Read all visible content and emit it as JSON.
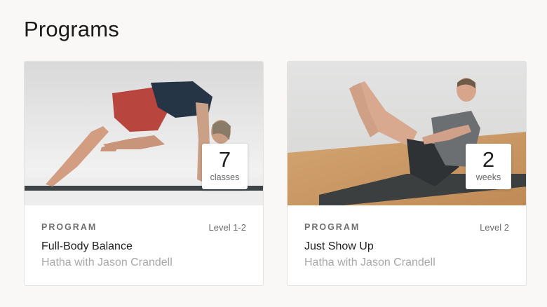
{
  "page": {
    "title": "Programs"
  },
  "programs": [
    {
      "kind_label": "PROGRAM",
      "level": "Level 1-2",
      "title": "Full-Body Balance",
      "subtitle": "Hatha with Jason Crandell",
      "count": "7",
      "count_unit": "classes"
    },
    {
      "kind_label": "PROGRAM",
      "level": "Level 2",
      "title": "Just Show Up",
      "subtitle": "Hatha with Jason Crandell",
      "count": "2",
      "count_unit": "weeks"
    }
  ],
  "colors": {
    "background": "#f9f8f7",
    "card": "#ffffff",
    "muted_text": "#a8a8a8",
    "label_text": "#6f6f6f"
  }
}
